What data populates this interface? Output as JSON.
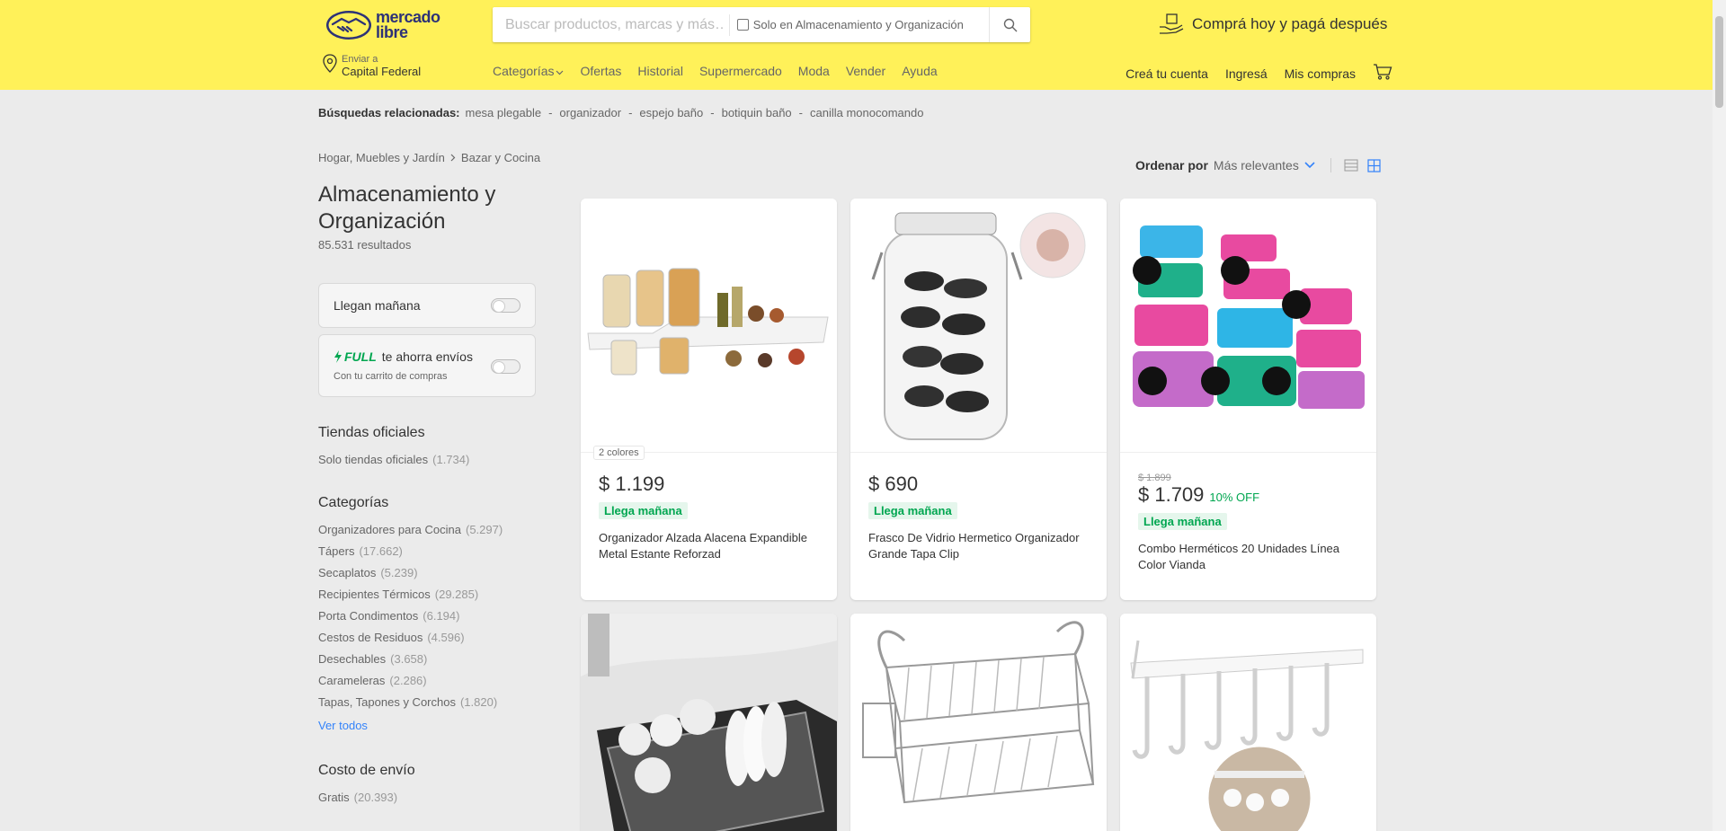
{
  "header": {
    "logo_line1": "mercado",
    "logo_line2": "libre",
    "search_placeholder": "Buscar productos, marcas y más…",
    "search_filter_label": "Solo en Almacenamiento y Organización",
    "promo": "Comprá hoy y pagá después",
    "location_small": "Enviar a",
    "location_big": "Capital Federal",
    "nav": [
      "Categorías",
      "Ofertas",
      "Historial",
      "Supermercado",
      "Moda",
      "Vender",
      "Ayuda"
    ],
    "nav_right": [
      "Creá tu cuenta",
      "Ingresá",
      "Mis compras"
    ]
  },
  "related": {
    "label": "Búsquedas relacionadas:",
    "items": [
      "mesa plegable",
      "organizador",
      "espejo baño",
      "botiquin baño",
      "canilla monocomando"
    ]
  },
  "breadcrumb": [
    "Hogar, Muebles y Jardín",
    "Bazar y Cocina"
  ],
  "page": {
    "title": "Almacenamiento y Organización",
    "results": "85.531 resultados"
  },
  "filters": {
    "llegan": "Llegan mañana",
    "full_label": "FULL",
    "full_text": "te ahorra envíos",
    "full_sub": "Con tu carrito de compras",
    "tiendas_title": "Tiendas oficiales",
    "tiendas_item": "Solo tiendas oficiales",
    "tiendas_count": "(1.734)",
    "categorias_title": "Categorías",
    "categorias": [
      {
        "name": "Organizadores para Cocina",
        "count": "(5.297)"
      },
      {
        "name": "Tápers",
        "count": "(17.662)"
      },
      {
        "name": "Secaplatos",
        "count": "(5.239)"
      },
      {
        "name": "Recipientes Térmicos",
        "count": "(29.285)"
      },
      {
        "name": "Porta Condimentos",
        "count": "(6.194)"
      },
      {
        "name": "Cestos de Residuos",
        "count": "(4.596)"
      },
      {
        "name": "Desechables",
        "count": "(3.658)"
      },
      {
        "name": "Carameleras",
        "count": "(2.286)"
      },
      {
        "name": "Tapas, Tapones y Corchos",
        "count": "(1.820)"
      }
    ],
    "ver_todos": "Ver todos",
    "envio_title": "Costo de envío",
    "envio_item": "Gratis",
    "envio_count": "(20.393)"
  },
  "sort": {
    "label": "Ordenar por",
    "value": "Más relevantes"
  },
  "products": [
    {
      "badge": "2 colores",
      "price": "$ 1.199",
      "delivery": "Llega mañana",
      "title": "Organizador Alzada Alacena Expandible Metal Estante Reforzad"
    },
    {
      "price": "$ 690",
      "delivery": "Llega mañana",
      "title": "Frasco De Vidrio Hermetico Organizador Grande Tapa Clip"
    },
    {
      "old_price": "$ 1.899",
      "price": "$ 1.709",
      "off": "10% OFF",
      "delivery": "Llega mañana",
      "title": "Combo Herméticos 20 Unidades Línea Color Vianda"
    }
  ],
  "colors": {
    "brand_yellow": "#fff159",
    "link_blue": "#3483fa",
    "green": "#00a650"
  }
}
